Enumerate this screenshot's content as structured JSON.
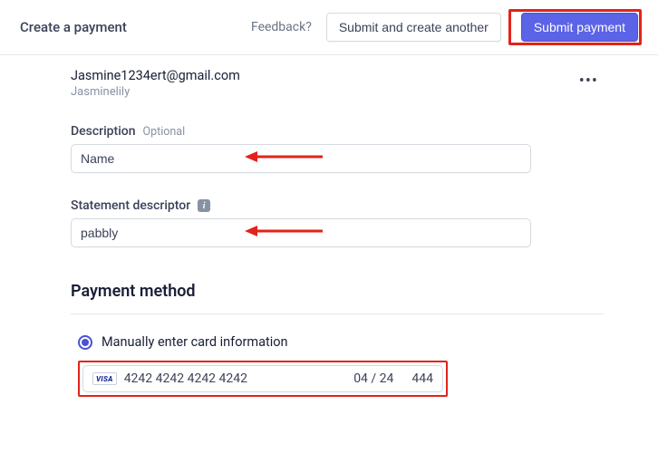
{
  "header": {
    "title": "Create a payment",
    "feedback": "Feedback?",
    "submit_another_label": "Submit and create another",
    "submit_label": "Submit payment"
  },
  "customer": {
    "email": "Jasmine1234ert@gmail.com",
    "name": "Jasminelily"
  },
  "description": {
    "label": "Description",
    "optional": "Optional",
    "value": "Name"
  },
  "statement": {
    "label": "Statement descriptor",
    "value": "pabbly"
  },
  "payment_method": {
    "title": "Payment method",
    "radio_label": "Manually enter card information",
    "card_brand": "VISA",
    "card_number": "4242 4242 4242 4242",
    "card_expiry": "04 / 24",
    "card_cvc": "444"
  }
}
